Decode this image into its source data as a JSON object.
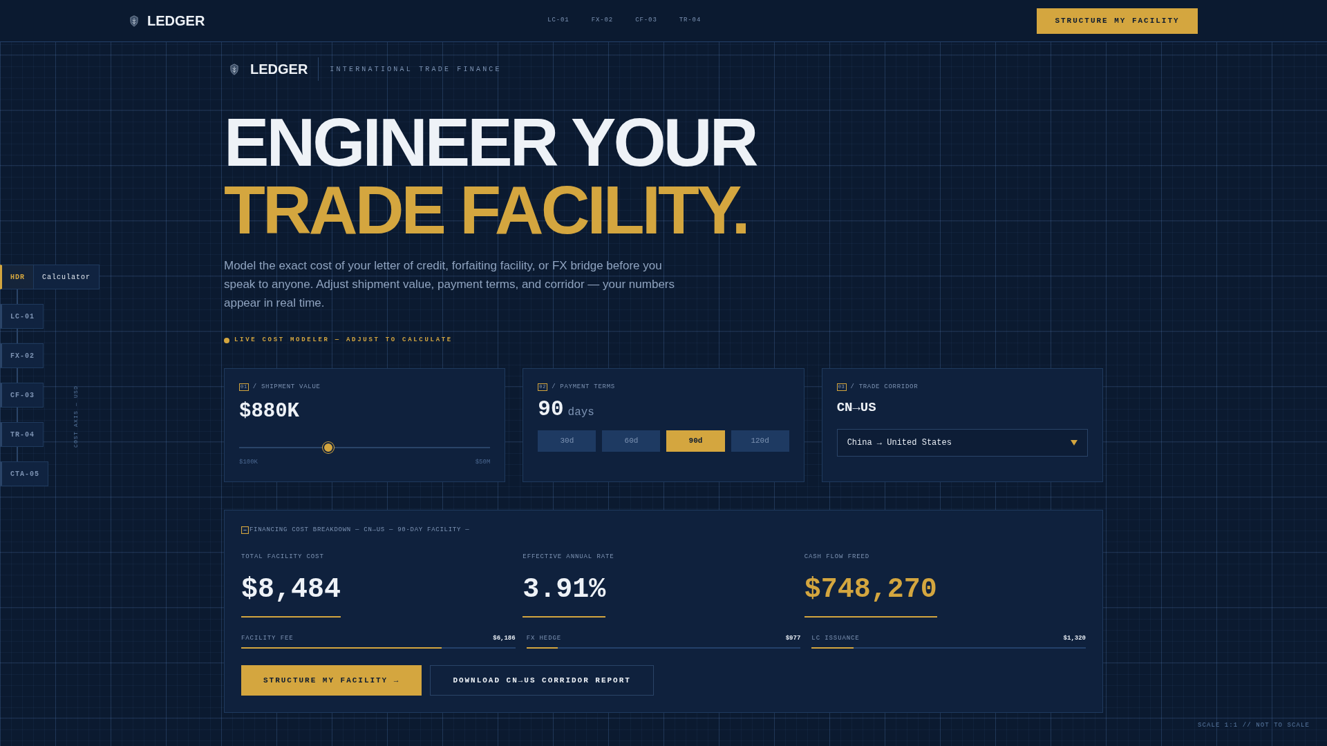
{
  "navbar": {
    "brand": "LEDGER",
    "links": [
      "LC-01",
      "FX-02",
      "CF-03",
      "TR-04"
    ],
    "cta": "STRUCTURE MY FACILITY"
  },
  "sidebar": {
    "items": [
      {
        "code": "HDR",
        "label": "Calculator",
        "selected": true
      },
      {
        "code": "LC-01",
        "selected": false
      },
      {
        "code": "FX-02",
        "selected": false
      },
      {
        "code": "CF-03",
        "selected": false
      },
      {
        "code": "TR-04",
        "selected": false
      },
      {
        "code": "CTA-05",
        "selected": false
      }
    ],
    "axis_label": "COST AXIS — USD"
  },
  "hero": {
    "brand": "LEDGER",
    "tagline": "INTERNATIONAL TRADE FINANCE",
    "headline_1": "ENGINEER YOUR",
    "headline_2": "TRADE FACILITY.",
    "description": "Model the exact cost of your letter of credit, forfaiting facility, or FX bridge before you speak to anyone. Adjust shipment value, payment terms, and corridor — your numbers appear in real time.",
    "live_label": "LIVE COST MODELER — ADJUST TO CALCULATE"
  },
  "inputs": [
    {
      "kind": "slider",
      "index": "01",
      "separator": "/",
      "label": "SHIPMENT VALUE",
      "value": "$880K",
      "level": 0.356,
      "min_label": "$100K",
      "max_label": "$50M"
    },
    {
      "kind": "options",
      "index": "02",
      "separator": "/",
      "label": "PAYMENT TERMS",
      "value": "90",
      "unit": "days",
      "options": [
        {
          "label": "30d",
          "selected": false
        },
        {
          "label": "60d",
          "selected": false
        },
        {
          "label": "90d",
          "selected": true
        },
        {
          "label": "120d",
          "selected": false
        }
      ]
    },
    {
      "kind": "select",
      "index": "03",
      "separator": "/",
      "label": "TRADE CORRIDOR",
      "value": "CN→US",
      "select_value": "China → United States"
    }
  ],
  "breakdown": {
    "title": "FINANCING COST BREAKDOWN — CN→US — 90-DAY FACILITY —",
    "metrics": [
      {
        "label": "TOTAL FACILITY COST",
        "value": "$8,484",
        "highlight": false
      },
      {
        "label": "EFFECTIVE ANNUAL RATE",
        "value": "3.91%",
        "highlight": false
      },
      {
        "label": "CASH FLOW FREED",
        "value": "$748,270",
        "highlight": true
      }
    ],
    "components": [
      {
        "label": "FACILITY FEE",
        "amount": "$6,186",
        "level": 0.73
      },
      {
        "label": "FX HEDGE",
        "amount": "$977",
        "level": 0.114
      },
      {
        "label": "LC ISSUANCE",
        "amount": "$1,320",
        "level": 0.154
      }
    ],
    "buttons": [
      {
        "label": "STRUCTURE MY FACILITY →",
        "kind": "primary"
      },
      {
        "label": "DOWNLOAD CN→US CORRIDOR REPORT",
        "kind": "secondary"
      }
    ]
  },
  "footer_note": "SCALE 1:1 // NOT TO SCALE"
}
